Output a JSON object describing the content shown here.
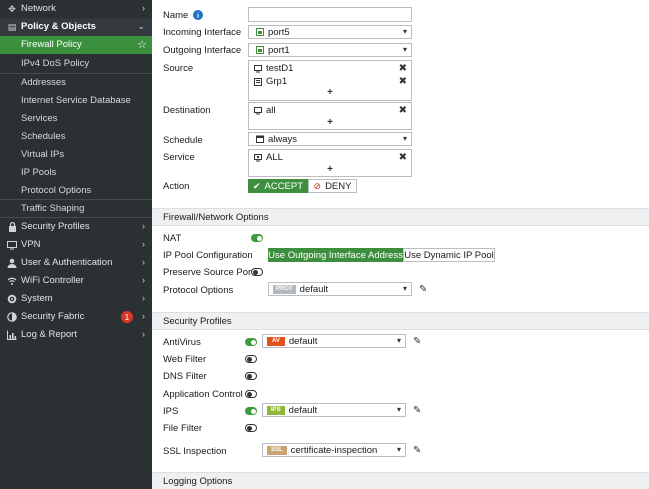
{
  "sidebar": {
    "items": [
      {
        "label": "Network",
        "icon": "network-icon",
        "glyph": "✥",
        "chev": "›"
      },
      {
        "label": "Policy & Objects",
        "icon": "policy-icon",
        "glyph": "▤",
        "chev": "⌄"
      },
      {
        "label": "Firewall Policy",
        "star": "☆"
      },
      {
        "label": "IPv4 DoS Policy"
      },
      {
        "label": "Addresses"
      },
      {
        "label": "Internet Service Database"
      },
      {
        "label": "Services"
      },
      {
        "label": "Schedules"
      },
      {
        "label": "Virtual IPs"
      },
      {
        "label": "IP Pools"
      },
      {
        "label": "Protocol Options"
      },
      {
        "label": "Traffic Shaping"
      },
      {
        "label": "Security Profiles",
        "icon": "lock-icon",
        "glyph": "🔒",
        "chev": "›"
      },
      {
        "label": "VPN",
        "icon": "monitor-icon",
        "glyph": "▭",
        "chev": "›"
      },
      {
        "label": "User & Authentication",
        "icon": "user-icon",
        "glyph": "●",
        "chev": "›"
      },
      {
        "label": "WiFi Controller",
        "icon": "wifi-icon",
        "glyph": "◉",
        "chev": "›"
      },
      {
        "label": "System",
        "icon": "gear-icon",
        "glyph": "✺",
        "chev": "›"
      },
      {
        "label": "Security Fabric",
        "icon": "fabric-icon",
        "glyph": "◑",
        "chev": "›",
        "badge": "1"
      },
      {
        "label": "Log & Report",
        "icon": "chart-icon",
        "glyph": "▥",
        "chev": "›"
      }
    ]
  },
  "form": {
    "name_label": "Name",
    "name_info": "i",
    "name_value": "",
    "incoming_label": "Incoming Interface",
    "incoming_value": "port5",
    "outgoing_label": "Outgoing Interface",
    "outgoing_value": "port1",
    "source_label": "Source",
    "source_items": [
      "testD1",
      "Grp1"
    ],
    "destination_label": "Destination",
    "destination_items": [
      "all"
    ],
    "schedule_label": "Schedule",
    "schedule_value": "always",
    "service_label": "Service",
    "service_items": [
      "ALL"
    ],
    "action_label": "Action",
    "accept_label": "ACCEPT",
    "deny_label": "DENY",
    "remove_glyph": "✖",
    "add_glyph": "+",
    "caret_glyph": "▾"
  },
  "firewall_network": {
    "title": "Firewall/Network Options",
    "nat_label": "NAT",
    "nat_on": true,
    "ip_pool_label": "IP Pool Configuration",
    "ip_pool_option1": "Use Outgoing Interface Address",
    "ip_pool_option2": "Use Dynamic IP Pool",
    "preserve_label": "Preserve Source Port",
    "preserve_on": false,
    "protocol_label": "Protocol Options",
    "protocol_tag": "PROT",
    "protocol_value": "default"
  },
  "security_profiles": {
    "title": "Security Profiles",
    "antivirus_label": "AntiVirus",
    "antivirus_on": true,
    "antivirus_tag": "AV",
    "antivirus_value": "default",
    "webfilter_label": "Web Filter",
    "webfilter_on": false,
    "dnsfilter_label": "DNS Filter",
    "dnsfilter_on": false,
    "appcontrol_label": "Application Control",
    "appcontrol_on": false,
    "ips_label": "IPS",
    "ips_on": true,
    "ips_tag": "IPS",
    "ips_value": "default",
    "filefilter_label": "File Filter",
    "filefilter_on": false,
    "ssl_label": "SSL Inspection",
    "ssl_tag": "SSL",
    "ssl_value": "certificate-inspection"
  },
  "logging": {
    "title": "Logging Options"
  },
  "colors": {
    "sidebar_bg": "#2b3033",
    "active_green": "#3c8f3c",
    "av_tag": "#e2521d",
    "ips_tag": "#8fb83a",
    "ssl_tag": "#c8a472",
    "prot_tag": "#b3b8bc",
    "badge_red": "#d9372b"
  }
}
